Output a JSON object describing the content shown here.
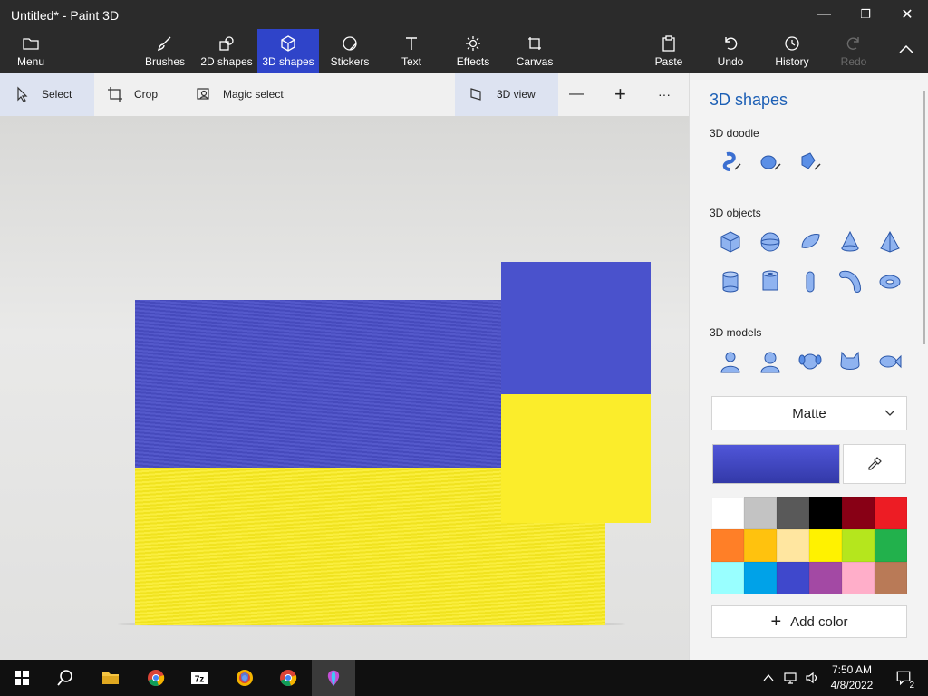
{
  "window": {
    "title": "Untitled* - Paint 3D",
    "minimize": "—",
    "restore": "❐",
    "close": "✕"
  },
  "ribbon": {
    "menu": "Menu",
    "brushes": "Brushes",
    "shapes2d": "2D shapes",
    "shapes3d": "3D shapes",
    "stickers": "Stickers",
    "text": "Text",
    "effects": "Effects",
    "canvas": "Canvas",
    "paste": "Paste",
    "undo": "Undo",
    "history": "History",
    "redo": "Redo"
  },
  "toolbar": {
    "select": "Select",
    "crop": "Crop",
    "magic_select": "Magic select",
    "view3d": "3D view",
    "zoom_out": "—",
    "zoom_in": "+",
    "more": "···"
  },
  "panel": {
    "title": "3D shapes",
    "doodle_label": "3D doodle",
    "objects_label": "3D objects",
    "models_label": "3D models",
    "material": "Matte",
    "add_color": "Add color",
    "selected_color": "#4a52d0",
    "palette": [
      "#ffffff",
      "#c3c3c3",
      "#595959",
      "#000000",
      "#880015",
      "#ed1c24",
      "#ff7f27",
      "#ffc20e",
      "#ffe6a0",
      "#fff200",
      "#b5e61d",
      "#22b14c",
      "#99ffff",
      "#00a2e8",
      "#3f48cc",
      "#a349a4",
      "#ffaec9",
      "#b97a57"
    ]
  },
  "canvas": {
    "colors": {
      "blue": "#4a4fc8",
      "yellow": "#f9ec23"
    }
  },
  "taskbar": {
    "time": "7:50 AM",
    "date": "4/8/2022",
    "notifications": "2"
  }
}
